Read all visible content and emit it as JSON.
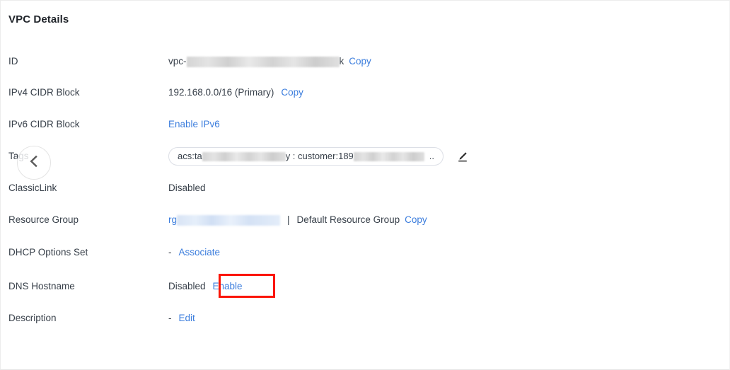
{
  "panel": {
    "title": "VPC Details"
  },
  "rows": [
    {
      "label": "ID",
      "prefix": "vpc-",
      "redacted": true,
      "suffix": "k",
      "action": "Copy"
    },
    {
      "label": "IPv4 CIDR Block",
      "value": "192.168.0.0/16 (Primary)",
      "action": "Copy"
    },
    {
      "label": "IPv6 CIDR Block",
      "action": "Enable IPv6"
    },
    {
      "label": "Tags",
      "tag_chip": {
        "prefix": "acs:ta",
        "mid": "y : customer:189",
        "suffix": ".."
      },
      "edit_icon": "pencil-icon"
    },
    {
      "label": "ClassicLink",
      "value": "Disabled"
    },
    {
      "label": "Resource Group",
      "prefix": "rg",
      "separator": "|",
      "value": "Default Resource Group",
      "action": "Copy"
    },
    {
      "label": "DHCP Options Set",
      "value": "-",
      "action": "Associate"
    },
    {
      "label": "DNS Hostname",
      "value": "Disabled",
      "action": "Enable",
      "highlighted": true
    },
    {
      "label": "Description",
      "value": "-",
      "action": "Edit"
    }
  ],
  "collapse_button": {
    "icon": "chevron-left-icon",
    "label": "<"
  },
  "colors": {
    "link": "#3b7ddd",
    "text": "#38404a",
    "title": "#1f2329",
    "highlight": "#fb1406",
    "chip_border": "#dcdfe6"
  }
}
